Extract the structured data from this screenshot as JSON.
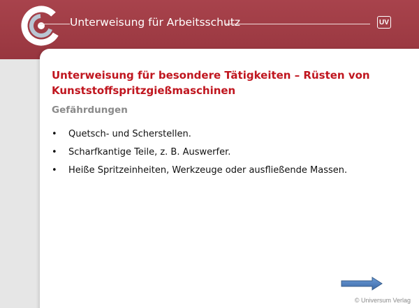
{
  "header": {
    "title": "Unterweisung für Arbeitsschutz",
    "badge": "UV",
    "logo_icon": "universum-logo-icon"
  },
  "slide": {
    "title": "Unterweisung für besondere Tätigkeiten – Rüsten von Kunststoffspritzgießmaschinen",
    "section": "Gefährdungen",
    "bullets": [
      "Quetsch- und Scherstellen.",
      "Scharfkantige Teile, z. B. Auswerfer.",
      "Heiße Spritzeinheiten, Werkzeuge oder ausfließende Massen."
    ]
  },
  "navigation": {
    "next_icon": "arrow-right-icon"
  },
  "footer": {
    "copyright": "© Universum Verlag"
  },
  "colors": {
    "header_bg": "#a03c45",
    "title_red": "#c0161f",
    "section_gray": "#8a8a8a",
    "arrow_blue": "#4f81bd"
  }
}
